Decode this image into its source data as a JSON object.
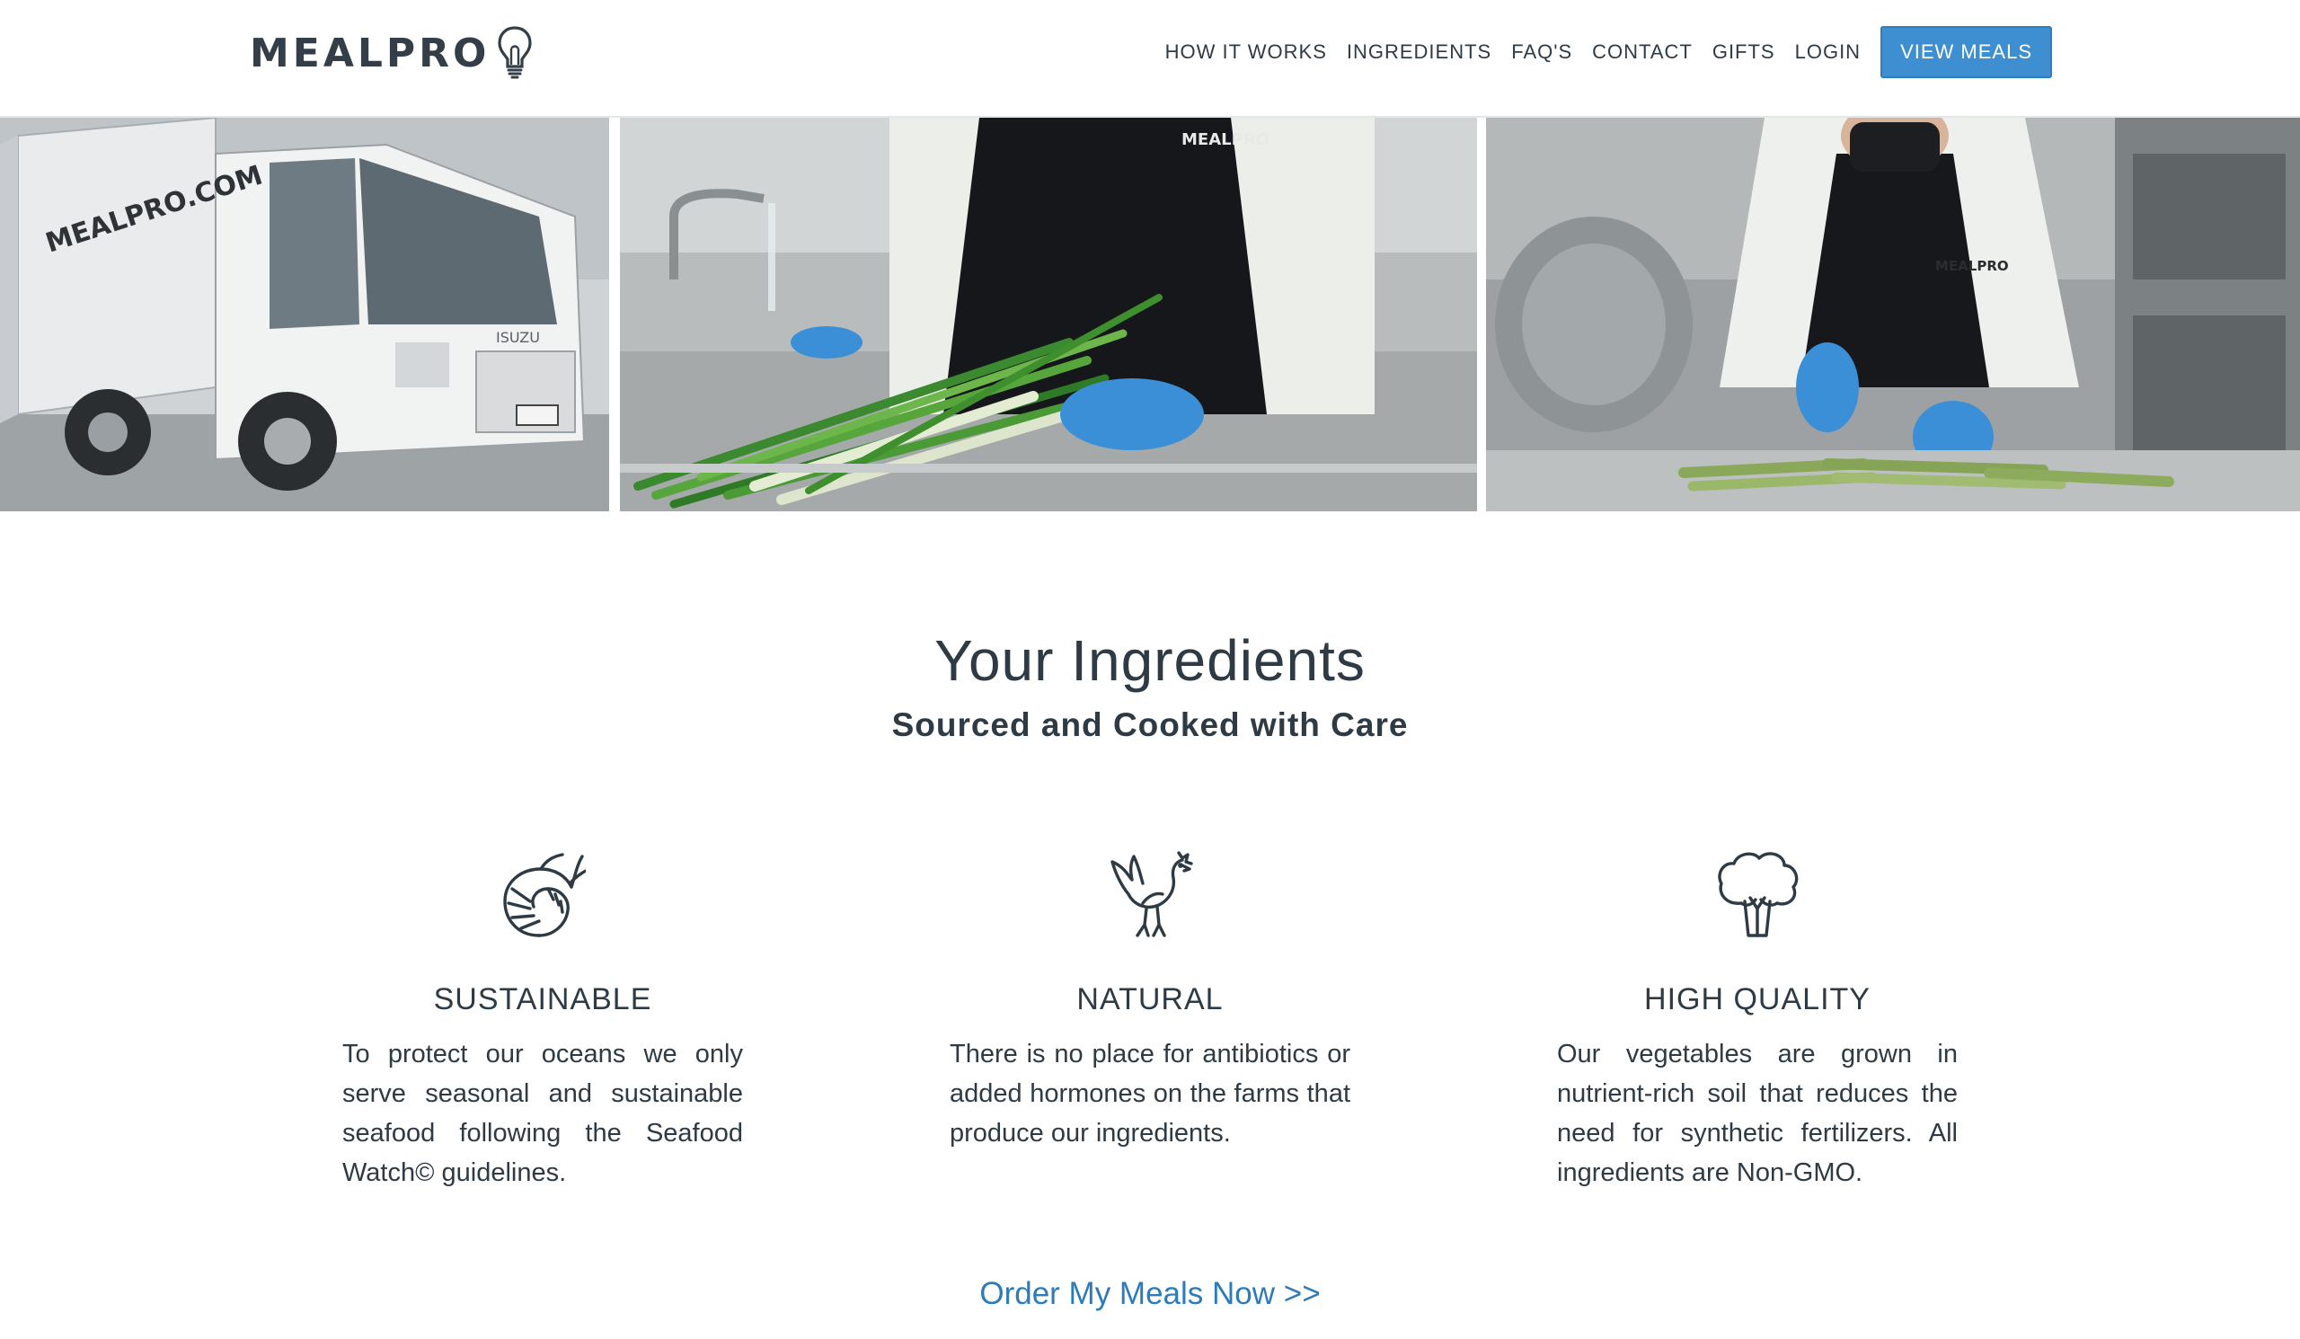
{
  "header": {
    "logo_text": "MEALPRO",
    "nav": {
      "how_it_works": "HOW IT WORKS",
      "ingredients": "INGREDIENTS",
      "faqs": "FAQ'S",
      "contact": "CONTACT",
      "gifts": "GIFTS",
      "login": "LOGIN",
      "view_meals": "VIEW MEALS"
    },
    "accent_color": "#3d8fd1"
  },
  "hero": {
    "photos": [
      {
        "name": "delivery-truck-photo",
        "truck_text": "MEALPRO.COM",
        "badge": "ISUZU"
      },
      {
        "name": "chef-washing-green-onions-photo",
        "apron_text": "MEALPRO"
      },
      {
        "name": "chef-cutting-asparagus-photo",
        "apron_text": "MEALPRO"
      }
    ]
  },
  "section": {
    "title": "Your Ingredients",
    "subtitle": "Sourced and Cooked with Care"
  },
  "features": [
    {
      "icon": "shrimp-icon",
      "title": "SUSTAINABLE",
      "text": "To protect our oceans we only serve seasonal and sustainable seafood following the Seafood Watch© guidelines."
    },
    {
      "icon": "rooster-icon",
      "title": "NATURAL",
      "text": "There is no place for antibiotics or added hormones on the farms that produce our ingredients."
    },
    {
      "icon": "broccoli-icon",
      "title": "HIGH QUALITY",
      "text": "Our vegetables are grown in nutrient-rich soil that reduces the need for synthetic fertilizers. All ingredients are Non-GMO."
    }
  ],
  "cta": {
    "order_label": "Order My Meals Now >>",
    "link_color": "#2e7bb9"
  }
}
